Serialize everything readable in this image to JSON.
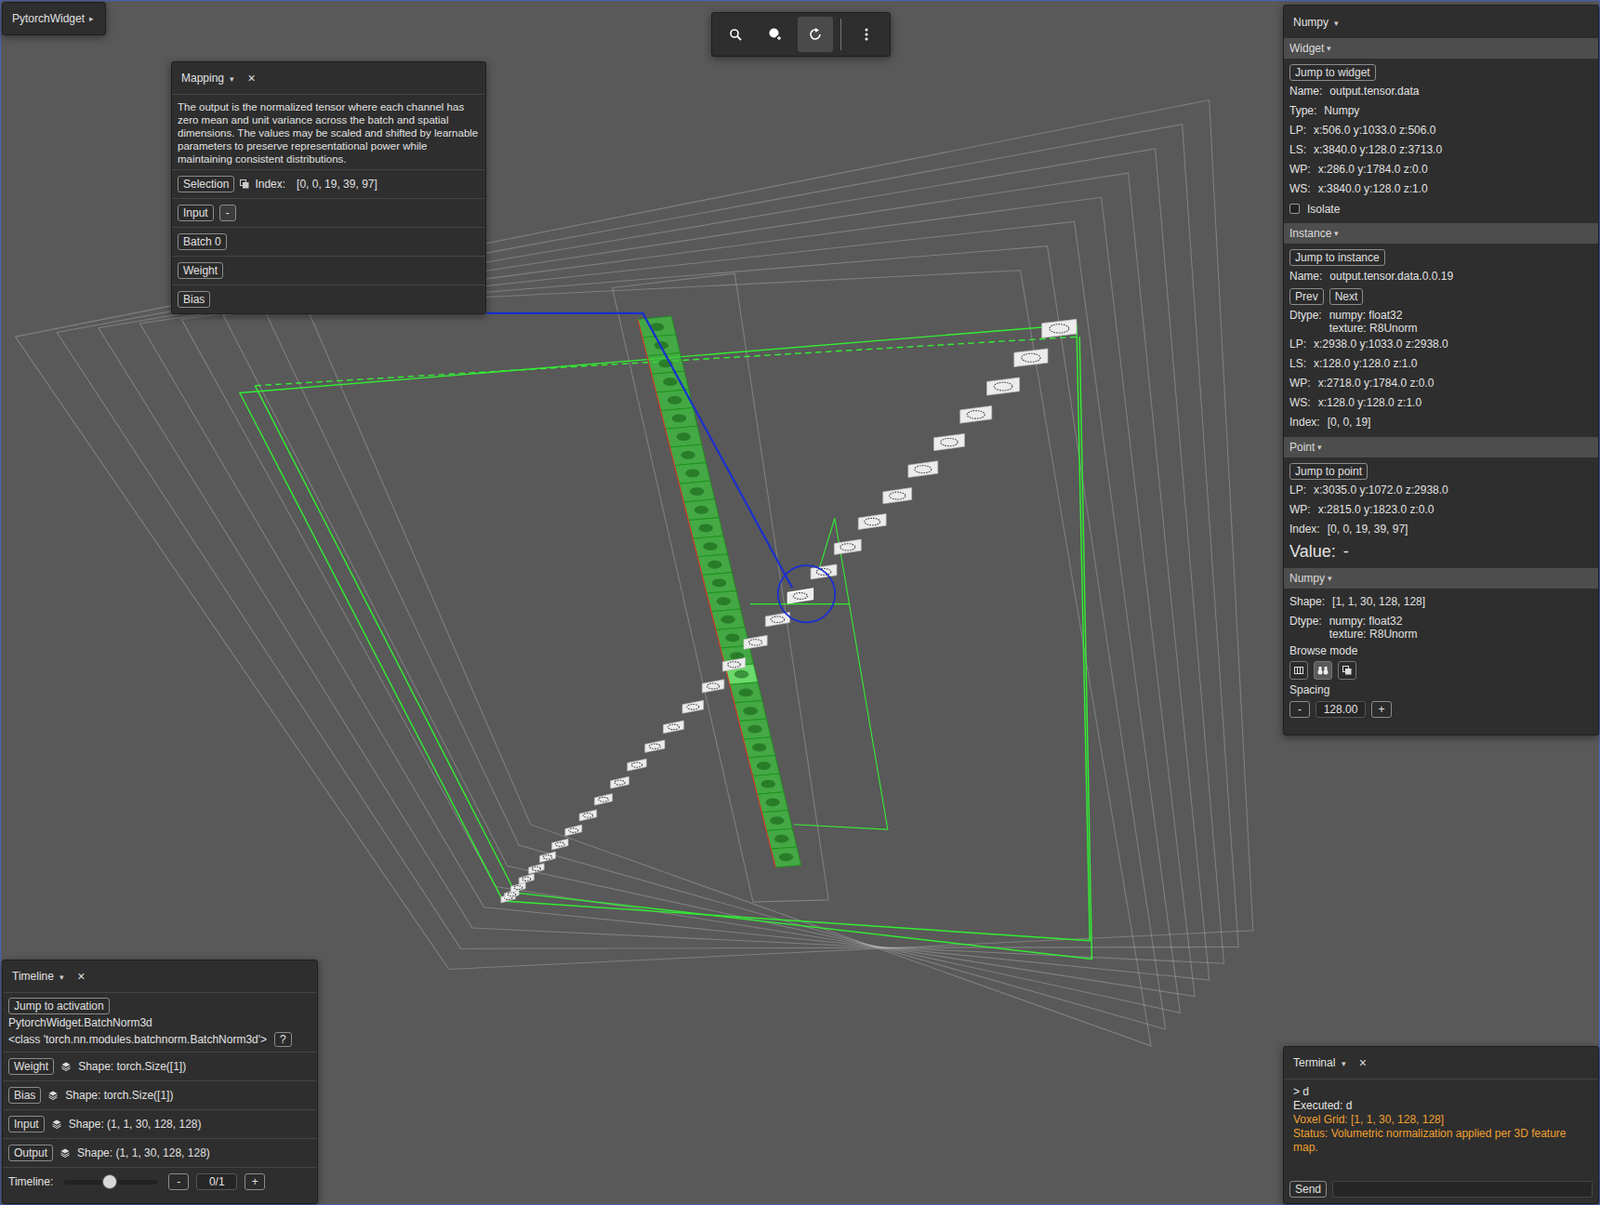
{
  "app_button": {
    "label": "PytorchWidget",
    "arrow": "▸"
  },
  "toolbar": [
    {
      "kind": "search",
      "selected": false
    },
    {
      "kind": "zoom",
      "selected": false
    },
    {
      "kind": "rotate",
      "selected": true
    },
    {
      "kind": "separator",
      "selected": false
    },
    {
      "kind": "more",
      "selected": false
    }
  ],
  "mapping": {
    "title": "Mapping",
    "arrow": "▾",
    "close": "×",
    "description": "The output is the normalized tensor where each channel has zero mean and unit variance across the batch and spatial dimensions. The values may be scaled and shifted by learnable parameters to preserve representational power while maintaining consistent distributions.",
    "selection_button": "Selection",
    "index_label": "Index:",
    "index": "[0, 0, 19, 39, 97]",
    "rows": [
      {
        "label": "Input",
        "extra": "-"
      },
      {
        "label": "Batch 0"
      },
      {
        "label": "Weight"
      },
      {
        "label": "Bias"
      }
    ]
  },
  "inspector": {
    "title": "Numpy",
    "arrow": "▾",
    "sections": [
      {
        "title": "Widget",
        "arrow": "▾",
        "items": [
          {
            "kind": "button",
            "label": "Jump to widget"
          },
          {
            "kind": "field",
            "label": "Name:",
            "lines": [
              "output.tensor.data"
            ]
          },
          {
            "kind": "field",
            "label": "Type:",
            "lines": [
              "Numpy"
            ]
          },
          {
            "kind": "field",
            "label": "LP:",
            "lines": [
              "x:506.0 y:1033.0 z:506.0"
            ]
          },
          {
            "kind": "field",
            "label": "LS:",
            "lines": [
              "x:3840.0 y:128.0 z:3713.0"
            ]
          },
          {
            "kind": "field",
            "label": "WP:",
            "lines": [
              "x:286.0 y:1784.0 z:0.0"
            ]
          },
          {
            "kind": "field",
            "label": "WS:",
            "lines": [
              "x:3840.0 y:128.0 z:1.0"
            ]
          },
          {
            "kind": "checkbox",
            "label": "Isolate",
            "checked": false
          }
        ]
      },
      {
        "title": "Instance",
        "arrow": "▾",
        "items": [
          {
            "kind": "button",
            "label": "Jump to instance"
          },
          {
            "kind": "field",
            "label": "Name:",
            "lines": [
              "output.tensor.data.0.0.19"
            ]
          },
          {
            "kind": "buttons",
            "labels": [
              "Prev",
              "Next"
            ]
          },
          {
            "kind": "field",
            "label": "Dtype:",
            "lines": [
              "numpy: float32",
              "texture: R8Unorm"
            ]
          },
          {
            "kind": "field",
            "label": "LP:",
            "lines": [
              "x:2938.0 y:1033.0 z:2938.0"
            ]
          },
          {
            "kind": "field",
            "label": "LS:",
            "lines": [
              "x:128.0 y:128.0 z:1.0"
            ]
          },
          {
            "kind": "field",
            "label": "WP:",
            "lines": [
              "x:2718.0 y:1784.0 z:0.0"
            ]
          },
          {
            "kind": "field",
            "label": "WS:",
            "lines": [
              "x:128.0 y:128.0 z:1.0"
            ]
          },
          {
            "kind": "field",
            "label": "Index:",
            "lines": [
              "[0, 0, 19]"
            ]
          }
        ]
      },
      {
        "title": "Point",
        "arrow": "▾",
        "items": [
          {
            "kind": "button",
            "label": "Jump to point"
          },
          {
            "kind": "field",
            "label": "LP:",
            "lines": [
              "x:3035.0 y:1072.0 z:2938.0"
            ]
          },
          {
            "kind": "field",
            "label": "WP:",
            "lines": [
              "x:2815.0 y:1823.0 z:0.0"
            ]
          },
          {
            "kind": "field",
            "label": "Index:",
            "lines": [
              "[0, 0, 19, 39, 97]"
            ]
          },
          {
            "kind": "value",
            "label": "Value:",
            "value": "-"
          }
        ]
      },
      {
        "title": "Numpy",
        "arrow": "▾",
        "items": [
          {
            "kind": "field",
            "label": "Shape:",
            "lines": [
              "[1, 1, 30, 128, 128]"
            ]
          },
          {
            "kind": "field",
            "label": "Dtype:",
            "lines": [
              "numpy: float32",
              "texture: R8Unorm"
            ]
          },
          {
            "kind": "label",
            "label": "Browse mode"
          },
          {
            "kind": "modes",
            "modes": [
              {
                "selected": false
              },
              {
                "selected": true
              },
              {
                "selected": false
              }
            ]
          },
          {
            "kind": "label",
            "label": "Spacing"
          },
          {
            "kind": "stepper",
            "minus": "-",
            "value": "128.00",
            "plus": "+"
          }
        ]
      }
    ]
  },
  "timeline": {
    "title": "Timeline",
    "arrow": "▾",
    "close": "×",
    "jump_button": "Jump to activation",
    "module": "PytorchWidget.BatchNorm3d",
    "class_name": "<class 'torch.nn.modules.batchnorm.BatchNorm3d'>",
    "help": "?",
    "tensors": [
      {
        "button": "Weight",
        "shape": "Shape: torch.Size([1])"
      },
      {
        "button": "Bias",
        "shape": "Shape: torch.Size([1])"
      },
      {
        "button": "Input",
        "shape": "Shape: (1, 1, 30, 128, 128)"
      },
      {
        "button": "Output",
        "shape": "Shape: (1, 1, 30, 128, 128)"
      }
    ],
    "slider": {
      "label": "Timeline:",
      "level": 0.49,
      "minus": "-",
      "value": "0/1",
      "plus": "+"
    }
  },
  "terminal": {
    "title": "Terminal",
    "arrow": "▾",
    "close": "×",
    "lines": [
      {
        "text": "> d",
        "color": "#e6e6e6"
      },
      {
        "text": "Executed: d",
        "color": "#e6e6e6"
      },
      {
        "text": "Voxel Grid: [1, 1, 30, 128, 128]",
        "color": "#f0a030"
      },
      {
        "text": "Status: Volumetric normalization applied per 3D feature map.",
        "color": "#f0a030"
      }
    ],
    "send": "Send"
  },
  "scene": {
    "slices": [
      {
        "selected": false
      },
      {
        "selected": false
      },
      {
        "selected": false
      },
      {
        "selected": false
      },
      {
        "selected": false
      },
      {
        "selected": false
      },
      {
        "selected": false
      },
      {
        "selected": false
      },
      {
        "selected": false
      },
      {
        "selected": false
      },
      {
        "selected": false
      },
      {
        "selected": false
      },
      {
        "selected": false
      },
      {
        "selected": false
      },
      {
        "selected": false
      },
      {
        "selected": false
      },
      {
        "selected": false
      },
      {
        "selected": false
      },
      {
        "selected": false
      },
      {
        "selected": true
      },
      {
        "selected": false
      },
      {
        "selected": false
      },
      {
        "selected": false
      },
      {
        "selected": false
      },
      {
        "selected": false
      },
      {
        "selected": false
      },
      {
        "selected": false
      },
      {
        "selected": false
      },
      {
        "selected": false
      },
      {
        "selected": false
      }
    ]
  }
}
